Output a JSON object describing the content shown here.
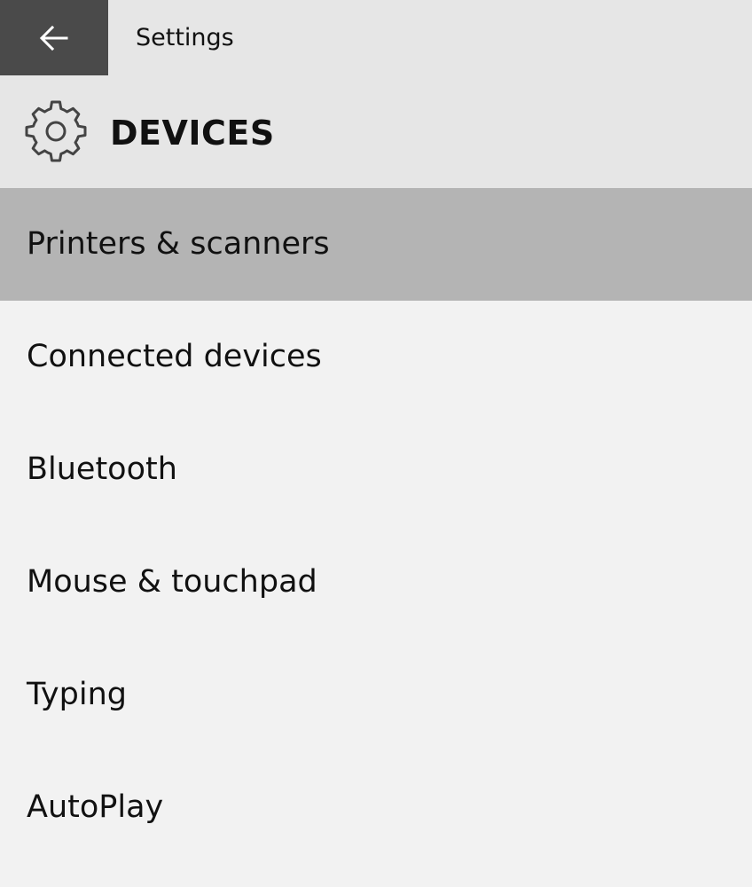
{
  "titlebar": {
    "back_icon": "back-arrow-icon",
    "title": "Settings"
  },
  "header": {
    "icon": "gear-icon",
    "title": "DEVICES"
  },
  "nav": {
    "selected_index": 0,
    "items": [
      {
        "label": "Printers & scanners"
      },
      {
        "label": "Connected devices"
      },
      {
        "label": "Bluetooth"
      },
      {
        "label": "Mouse & touchpad"
      },
      {
        "label": "Typing"
      },
      {
        "label": "AutoPlay"
      }
    ]
  },
  "colors": {
    "titlebar_bg": "#e6e6e6",
    "back_button_bg": "#4a4a4a",
    "page_bg": "#f2f2f2",
    "selected_bg": "#b4b4b4"
  }
}
